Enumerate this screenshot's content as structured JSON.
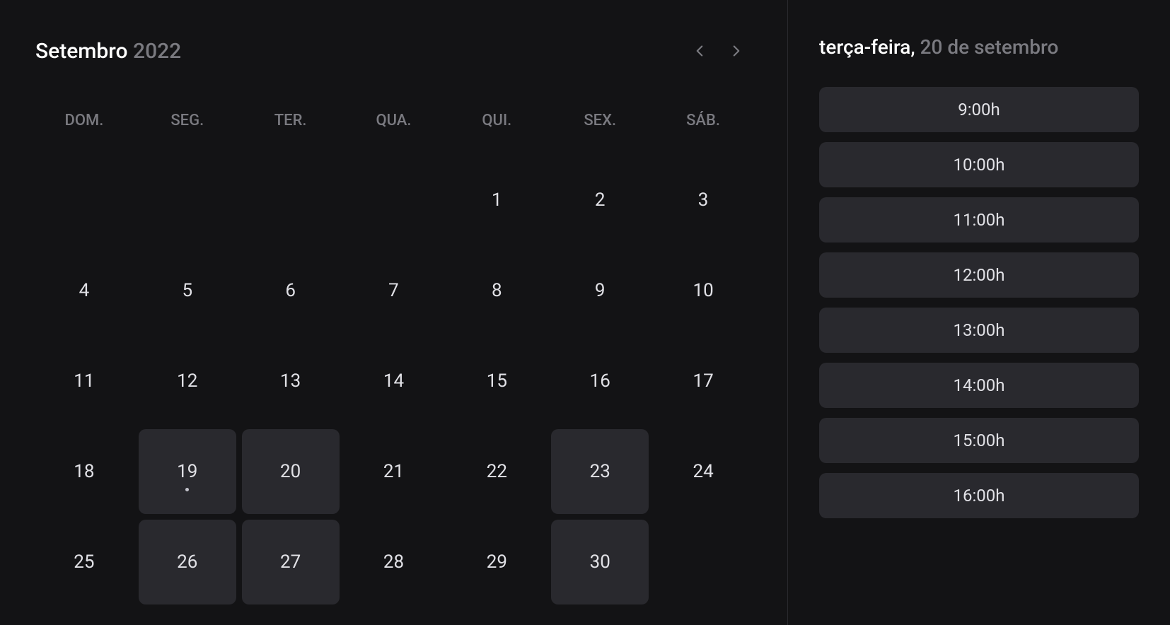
{
  "calendar": {
    "month": "Setembro",
    "year": "2022",
    "weekdays": [
      "DOM.",
      "SEG.",
      "TER.",
      "QUA.",
      "QUI.",
      "SEX.",
      "SÁB."
    ],
    "days": [
      {
        "num": "",
        "available": false,
        "today": false
      },
      {
        "num": "",
        "available": false,
        "today": false
      },
      {
        "num": "",
        "available": false,
        "today": false
      },
      {
        "num": "",
        "available": false,
        "today": false
      },
      {
        "num": "1",
        "available": false,
        "today": false
      },
      {
        "num": "2",
        "available": false,
        "today": false
      },
      {
        "num": "3",
        "available": false,
        "today": false
      },
      {
        "num": "4",
        "available": false,
        "today": false
      },
      {
        "num": "5",
        "available": false,
        "today": false
      },
      {
        "num": "6",
        "available": false,
        "today": false
      },
      {
        "num": "7",
        "available": false,
        "today": false
      },
      {
        "num": "8",
        "available": false,
        "today": false
      },
      {
        "num": "9",
        "available": false,
        "today": false
      },
      {
        "num": "10",
        "available": false,
        "today": false
      },
      {
        "num": "11",
        "available": false,
        "today": false
      },
      {
        "num": "12",
        "available": false,
        "today": false
      },
      {
        "num": "13",
        "available": false,
        "today": false
      },
      {
        "num": "14",
        "available": false,
        "today": false
      },
      {
        "num": "15",
        "available": false,
        "today": false
      },
      {
        "num": "16",
        "available": false,
        "today": false
      },
      {
        "num": "17",
        "available": false,
        "today": false
      },
      {
        "num": "18",
        "available": false,
        "today": false
      },
      {
        "num": "19",
        "available": true,
        "today": true
      },
      {
        "num": "20",
        "available": true,
        "today": false
      },
      {
        "num": "21",
        "available": false,
        "today": false
      },
      {
        "num": "22",
        "available": false,
        "today": false
      },
      {
        "num": "23",
        "available": true,
        "today": false
      },
      {
        "num": "24",
        "available": false,
        "today": false
      },
      {
        "num": "25",
        "available": false,
        "today": false
      },
      {
        "num": "26",
        "available": true,
        "today": false
      },
      {
        "num": "27",
        "available": true,
        "today": false
      },
      {
        "num": "28",
        "available": false,
        "today": false
      },
      {
        "num": "29",
        "available": false,
        "today": false
      },
      {
        "num": "30",
        "available": true,
        "today": false
      }
    ]
  },
  "timePanel": {
    "weekday": "terça-feira, ",
    "date": "20 de setembro",
    "slots": [
      "9:00h",
      "10:00h",
      "11:00h",
      "12:00h",
      "13:00h",
      "14:00h",
      "15:00h",
      "16:00h"
    ]
  }
}
